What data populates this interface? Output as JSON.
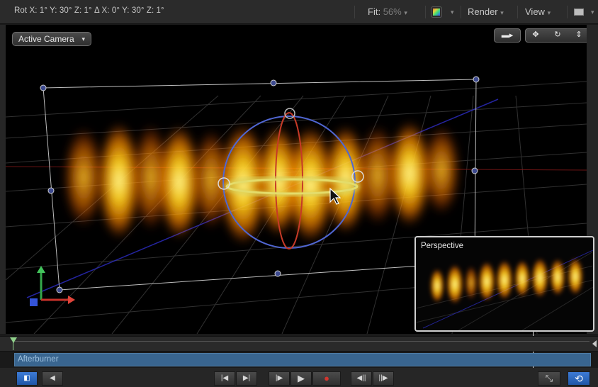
{
  "status_bar": {
    "rotation_readout": "Rot  X: 1° Y: 30° Z: 1°  Δ  X: 0° Y: 30° Z: 1°",
    "fit_label": "Fit:",
    "fit_value": "56%",
    "render_label": "Render",
    "view_label": "View",
    "dropdown_arrow": "▾"
  },
  "canvas": {
    "camera_menu": "Active Camera",
    "camera_menu_arrow": "▾",
    "tools": [
      {
        "name": "camera-icon",
        "glyph": "▬▸"
      },
      {
        "name": "pan-icon",
        "glyph": "✥"
      },
      {
        "name": "orbit-icon",
        "glyph": "↻"
      },
      {
        "name": "dolly-icon",
        "glyph": "⇕"
      }
    ]
  },
  "inset": {
    "title": "Perspective"
  },
  "timeline": {
    "track_name": "Afterburner"
  },
  "transport": {
    "buttons": [
      {
        "name": "toggle-layers-button",
        "glyph": "◧"
      },
      {
        "name": "mute-audio-button",
        "glyph": "◀"
      },
      {
        "name": "go-to-start-button",
        "glyph": "|◀"
      },
      {
        "name": "go-to-end-button",
        "glyph": "▶|"
      },
      {
        "name": "play-from-start-button",
        "glyph": "|▶"
      },
      {
        "name": "play-button",
        "glyph": "▶"
      },
      {
        "name": "record-button",
        "glyph": "●"
      },
      {
        "name": "previous-frame-button",
        "glyph": "◀||"
      },
      {
        "name": "next-frame-button",
        "glyph": "||▶"
      },
      {
        "name": "fullscreen-button",
        "glyph": "⤡"
      },
      {
        "name": "loop-button",
        "glyph": "⟲"
      }
    ]
  },
  "colors": {
    "track": "#39658f",
    "accent": "#2f6cc8",
    "fire_core": "#fff36a",
    "fire_outer": "#ff8a00",
    "sphere_blue": "#4f62c9",
    "sphere_red": "#c23a2a"
  }
}
